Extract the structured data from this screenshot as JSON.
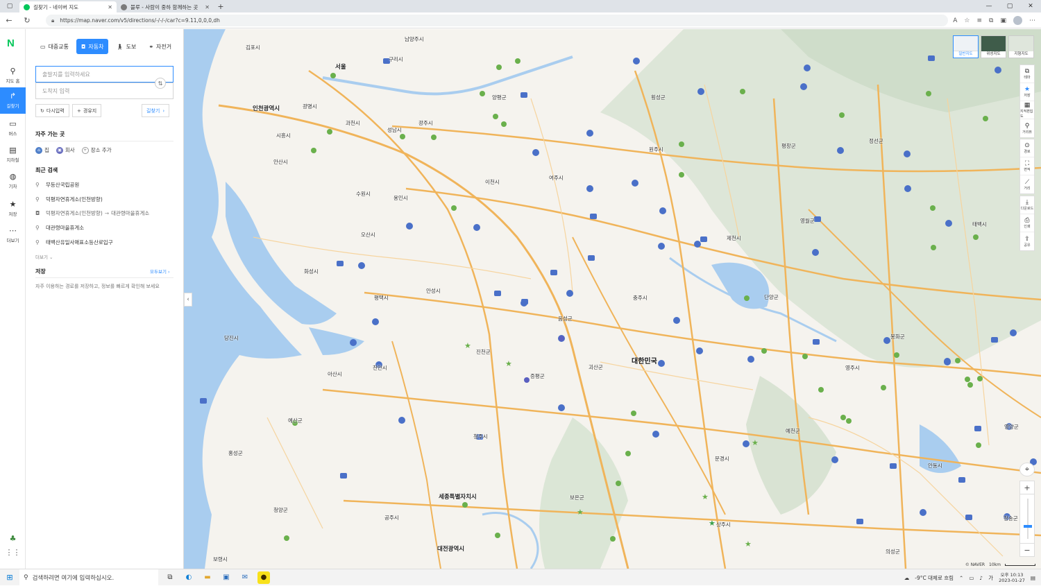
{
  "browser": {
    "tabs": [
      {
        "title": "길찾기 - 네이버 지도",
        "active": true,
        "color": "#03c75a"
      },
      {
        "title": "블루 - 사람이 중하 함께하는 곳",
        "active": false,
        "color": "#7a7a7a"
      }
    ],
    "url": "https://map.naver.com/v5/directions/-/-/-/car?c=9.11,0,0,0,dh"
  },
  "rail": {
    "items": [
      {
        "label": "지도 홈",
        "icon": "pin-icon"
      },
      {
        "label": "길찾기",
        "icon": "directions-icon"
      },
      {
        "label": "버스",
        "icon": "bus-icon"
      },
      {
        "label": "지하철",
        "icon": "subway-icon"
      },
      {
        "label": "기차",
        "icon": "train-icon"
      },
      {
        "label": "저장",
        "icon": "star-icon"
      },
      {
        "label": "더보기",
        "icon": "more-icon"
      }
    ]
  },
  "panel": {
    "modes": [
      "대중교통",
      "자동차",
      "도보",
      "자전거"
    ],
    "origin_placeholder": "출발지를 입력하세요",
    "dest_placeholder": "도착지 입력",
    "reset_label": "다시입력",
    "waypoint_label": "경유지",
    "search_label": "길찾기",
    "frequent_title": "자주 가는 곳",
    "frequent": [
      "집",
      "회사",
      "장소 추가"
    ],
    "recent_title": "최근 검색",
    "recent": [
      {
        "text": "무등산국립공원",
        "type": "place"
      },
      {
        "text": "덕평자연휴게소(인천방향)",
        "type": "place"
      },
      {
        "from": "덕평자연휴게소(인천방향)",
        "to": "대관령마을휴게소",
        "type": "route"
      },
      {
        "text": "대관령마을휴게소",
        "type": "place"
      },
      {
        "text": "태백산유일사매표소등산로입구",
        "type": "place"
      }
    ],
    "more_label": "더보기",
    "saved_title": "저장",
    "saved_all_label": "모두보기",
    "saved_desc": "자주 이용하는 경로를 저장하고, 정보를 빠르게 확인해 보세요"
  },
  "map": {
    "types": [
      "일반지도",
      "위성지도",
      "지형지도"
    ],
    "tools": [
      "테마",
      "저장",
      "지적편집도",
      "거리뷰",
      "경로",
      "면적",
      "거리",
      "다운로드",
      "인쇄",
      "공유"
    ],
    "labels": {
      "gimpo": "김포시",
      "seoul": "서울",
      "guri": "구리시",
      "namyangju": "남양주시",
      "incheon": "인천광역시",
      "gwangmyeong": "광명시",
      "gwacheon": "과천시",
      "seongnam": "성남시",
      "gwangju": "광주시",
      "yangpyeong": "양평군",
      "hoengseong": "횡성군",
      "wonju": "원주시",
      "pyeongchang": "평창군",
      "jeongseon": "정선군",
      "siheung": "시흥시",
      "ansan": "안산시",
      "suwon": "수원시",
      "yongin": "용인시",
      "icheon": "이천시",
      "yeoju": "여주시",
      "osan": "오산시",
      "hwaseong": "화성시",
      "yeongwol": "영월군",
      "jecheon": "제천시",
      "taebaek": "태백시",
      "pyeongtaek": "평택시",
      "anseong": "안성시",
      "chungju": "충주시",
      "danyang": "단양군",
      "dangjin": "당진시",
      "eumseong": "음성군",
      "jincheon": "진천군",
      "goesan": "괴산군",
      "korea": "대한민국",
      "bonghwa": "봉화군",
      "yeongju": "영주시",
      "cheonan": "천안시",
      "asan": "아산시",
      "jeungpyeong": "증평군",
      "yesan": "예산군",
      "cheongju": "청주시",
      "yecheon": "예천군",
      "yeongyang": "영양군",
      "hongseong": "홍성군",
      "mungyeong": "문경시",
      "andong": "안동시",
      "sejong": "세종특별자치시",
      "boeun": "보은군",
      "cheongyang": "청양군",
      "gongju": "공주시",
      "sangju": "상주시",
      "cheongsong": "청송군",
      "boryeong": "보령시",
      "daejeon": "대전광역시",
      "uiseong": "의성군"
    },
    "scale": "10km",
    "copyright": "© NAVER"
  },
  "taskbar": {
    "search_placeholder": "검색하려면 여기에 입력하십시오.",
    "weather": "-9°C 대체로 흐림",
    "time": "오후 10:13",
    "date": "2023-01-27",
    "ime": "가"
  },
  "colors": {
    "accent": "#2d8cff",
    "naver_green": "#03c75a",
    "road": "#f0b45a",
    "water": "#a9cdef"
  }
}
